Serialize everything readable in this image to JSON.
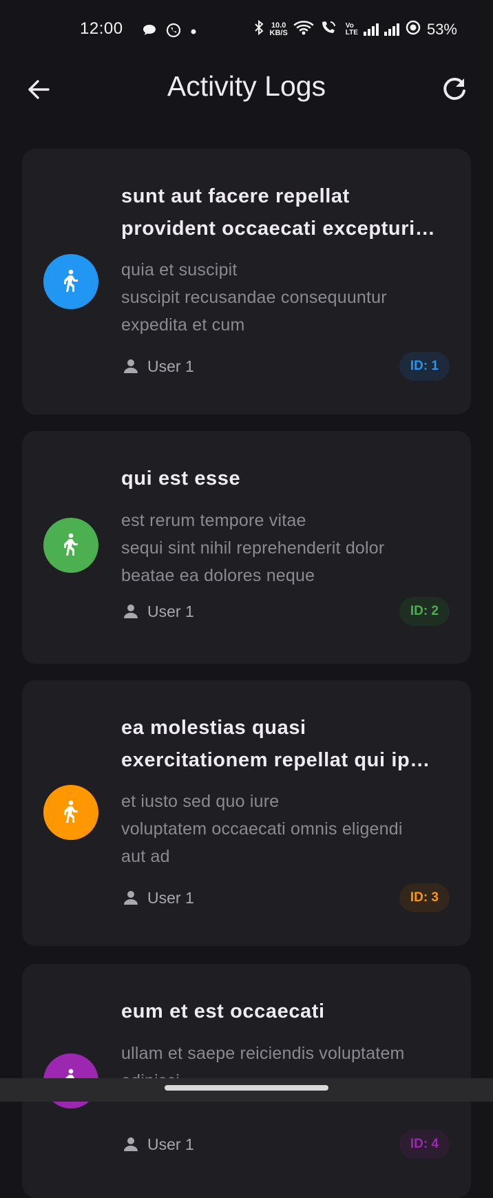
{
  "status_bar": {
    "time": "12:00",
    "net_speed_value": "10.0",
    "net_speed_unit": "KB/S",
    "volte_top": "Vo",
    "volte_bottom": "LTE",
    "battery": "53%"
  },
  "app_bar": {
    "title": "Activity Logs"
  },
  "theme": {
    "background": "#151418",
    "card": "#1F1E22"
  },
  "logs": [
    {
      "title_lines": [
        "sunt aut facere repellat",
        "provident occaecati excepturi…"
      ],
      "body_lines": [
        "quia et suscipit",
        "suscipit recusandae consequuntur",
        "expedita et cum"
      ],
      "user": "User 1",
      "id_label": "ID: 1",
      "color": "#2196F3",
      "badge_bg": "#1D2A3C"
    },
    {
      "title_lines": [
        "qui est esse"
      ],
      "body_lines": [
        "est rerum tempore vitae",
        "sequi sint nihil reprehenderit dolor",
        "beatae ea dolores neque"
      ],
      "user": "User 1",
      "id_label": "ID: 2",
      "color": "#4CAF50",
      "badge_bg": "#1F2E22"
    },
    {
      "title_lines": [
        "ea molestias quasi",
        "exercitationem repellat qui ip…"
      ],
      "body_lines": [
        "et iusto sed quo iure",
        "voluptatem occaecati omnis eligendi",
        "aut ad"
      ],
      "user": "User 1",
      "id_label": "ID: 3",
      "color": "#FF9800",
      "badge_bg": "#33261A"
    },
    {
      "title_lines": [
        "eum et est occaecati"
      ],
      "body_lines": [
        "ullam et saepe reiciendis voluptatem",
        "adipisci"
      ],
      "user": "User 1",
      "id_label": "ID: 4",
      "color": "#9C27B0",
      "badge_bg": "#2C1E30"
    }
  ]
}
